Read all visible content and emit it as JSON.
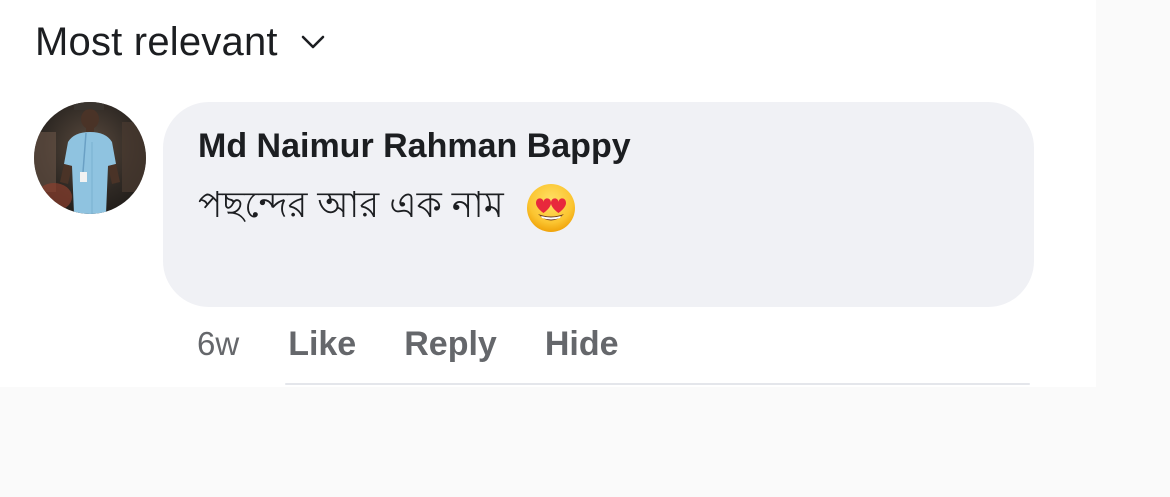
{
  "sort": {
    "label": "Most relevant",
    "icon": "chevron-down-icon"
  },
  "comment": {
    "author": "Md Naimur Rahman Bappy",
    "text": "পছন্দের আর এক নাম",
    "emoji": "smiling-face-with-heart-eyes",
    "time": "6w",
    "actions": {
      "like": "Like",
      "reply": "Reply",
      "hide": "Hide"
    }
  },
  "colors": {
    "bubble": "#f0f1f5",
    "primary_text": "#1c1e21",
    "secondary_text": "#65676b"
  }
}
